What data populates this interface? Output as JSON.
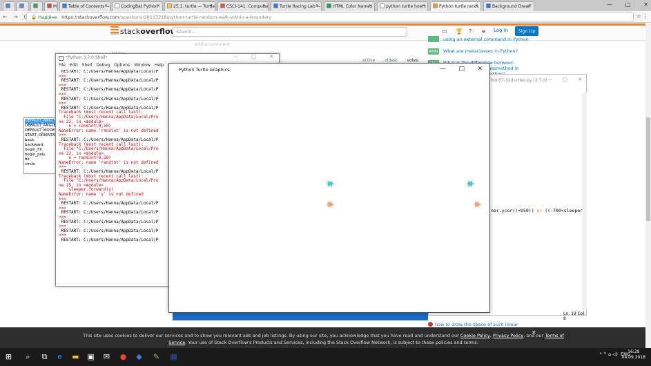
{
  "browser": {
    "tabs": [
      {
        "label": ""
      },
      {
        "label": ""
      },
      {
        "label": ""
      },
      {
        "label": "M"
      },
      {
        "label": "Table of Contents —"
      },
      {
        "label": "CodingBat Python"
      },
      {
        "label": "25.1. turtle — Turtle"
      },
      {
        "label": "CSCI-141: Computer"
      },
      {
        "label": "Turtle Racing Lab —"
      },
      {
        "label": "HTML Color Names"
      },
      {
        "label": "python turtle how t"
      },
      {
        "label": "Python turtle randc"
      },
      {
        "label": "Background Drawi"
      }
    ],
    "window_buttons": [
      "—",
      "□",
      "✕"
    ],
    "nav_buttons": "← → C",
    "secure_label": "Надійне",
    "url_host": "https://stackoverflow.com",
    "url_path": "/questions/28113218/python-turtle-random-walk-within-a-boundary",
    "star": "☆",
    "menu": "⋮"
  },
  "stackoverflow": {
    "logo_plain": "stack",
    "logo_bold": "overflow",
    "search_placeholder": "Search...",
    "login": "Log In",
    "signup": "Sign Up",
    "add_comment": "add a comment",
    "home": "Home",
    "sort_tabs": [
      "active",
      "oldest",
      "votes"
    ],
    "related": [
      {
        "count": "",
        "text": "using an external command in Python"
      },
      {
        "count": "4640",
        "text": "What are metaclasses in Python?"
      },
      {
        "count": "2717",
        "text": "What is the difference between"
      },
      {
        "count": "",
        "text": "lassmethod in"
      },
      {
        "count": "",
        "text": "Python?"
      }
    ],
    "bottom_question": "how to draw the space of such linear",
    "cookie_line1_a": "This site uses cookies to deliver our services and to show you relevant ads and job listings. By using our site, you acknowledge that you have read and understand our ",
    "cookie_link1": "Cookie Policy",
    "cookie_sep": ", ",
    "cookie_link2": "Privacy Policy",
    "cookie_and": ", and our ",
    "cookie_link3": "Terms of",
    "cookie_link4": "Service",
    "cookie_line2": ". Your use of Stack Overflow's Products and Services, including the Stack Overflow Network, is subject to these policies and terms.",
    "cookie_close": "✕"
  },
  "autocomplete": [
    "DEFAULT_ANGLE",
    "DEFAULT_ANGLE",
    "DEFAULT_MODE",
    "START_ORIENTAT",
    "back",
    "backward",
    "begin_fill",
    "begin_poly",
    "bk",
    "circle"
  ],
  "shell": {
    "title": "*Python 3.7.0 Shell*",
    "window_buttons": [
      "—",
      "□",
      "✕"
    ],
    "menu": [
      "File",
      "Edit",
      "Shell",
      "Debug",
      "Options",
      "Window",
      "Help"
    ],
    "lines": [
      {
        "t": " RESTART: C:/Users/Hanna/AppData/Local/P",
        "c": "k"
      },
      {
        "t": ">>>",
        "c": "r"
      },
      {
        "t": " RESTART: C:/Users/Hanna/AppData/Local/P",
        "c": "k"
      },
      {
        "t": ">>>",
        "c": "r"
      },
      {
        "t": " RESTART: C:/Users/Hanna/AppData/Local/P",
        "c": "k"
      },
      {
        "t": ">>>",
        "c": "r"
      },
      {
        "t": " RESTART: C:/Users/Hanna/AppData/Local/P",
        "c": "k"
      },
      {
        "t": ">>>",
        "c": "r"
      },
      {
        "t": " RESTART: C:/Users/Hanna/AppData/Local/P",
        "c": "k"
      },
      {
        "t": "Traceback (most recent call last):",
        "c": "r"
      },
      {
        "t": "  File \"C:/Users/Hanna/AppData/Local/Pro",
        "c": "r"
      },
      {
        "t": "ne 22, in <module>",
        "c": "r"
      },
      {
        "t": "    n = randint(0,50)",
        "c": "r"
      },
      {
        "t": "NameError: name 'randint' is not defined",
        "c": "r"
      },
      {
        "t": ">>>",
        "c": "r"
      },
      {
        "t": " RESTART: C:/Users/Hanna/AppData/Local/P",
        "c": "k"
      },
      {
        "t": "Traceback (most recent call last):",
        "c": "r"
      },
      {
        "t": "  File \"C:/Users/Hanna/AppData/Local/Pro",
        "c": "r"
      },
      {
        "t": "ne 22, in <module>",
        "c": "r"
      },
      {
        "t": "    n = randint(0,50)",
        "c": "r"
      },
      {
        "t": "NameError: name 'randint' is not defined",
        "c": "r"
      },
      {
        "t": ">>>",
        "c": "r"
      },
      {
        "t": " RESTART: C:/Users/Hanna/AppData/Local/P",
        "c": "k"
      },
      {
        "t": "Traceback (most recent call last):",
        "c": "r"
      },
      {
        "t": "  File \"C:/Users/Hanna/AppData/Local/Pro",
        "c": "r"
      },
      {
        "t": "ne 25, in <module>",
        "c": "r"
      },
      {
        "t": "    sleeper.forward(y)",
        "c": "r"
      },
      {
        "t": "NameError: name 'y' is not defined",
        "c": "r"
      },
      {
        "t": ">>>",
        "c": "r"
      },
      {
        "t": " RESTART: C:/Users/Hanna/AppData/Local/P",
        "c": "k"
      },
      {
        "t": ">>>",
        "c": "r"
      },
      {
        "t": " RESTART: C:/Users/Hanna/AppData/Local/P",
        "c": "k"
      },
      {
        "t": ">>>",
        "c": "r"
      },
      {
        "t": " RESTART: C:/Users/Hanna/AppData/Local/P",
        "c": "k"
      },
      {
        "t": ">>>",
        "c": "r"
      },
      {
        "t": " RESTART: C:/Users/Hanna/AppData/Local/P",
        "c": "k"
      },
      {
        "t": ">>>",
        "c": "r"
      },
      {
        "t": " RESTART: C:/Users/Hanna/AppData/Local/P",
        "c": "k"
      }
    ]
  },
  "turtle_window": {
    "title": "Python Turtle Graphics",
    "window_buttons": [
      "—",
      "□",
      "✕"
    ],
    "turtles": [
      {
        "color": "#4fc3d9"
      },
      {
        "color": "#4fc3d9"
      },
      {
        "color": "#f4a07a"
      },
      {
        "color": "#f4a07a"
      }
    ]
  },
  "editor": {
    "title": "hon37-32/turtles.py (3.7.0)",
    "window_buttons": [
      "—",
      "□",
      "✕"
    ],
    "code_a": "ner.ycor()<950)) ",
    "code_or": "or",
    "code_b": " ((-700<sleeper",
    "status": "Ln: 19  Col: 8"
  },
  "taskbar": {
    "tray_text": "ENG",
    "tray_icons": "ᴿ  ^  ⌂ ◁)",
    "time": "16:29",
    "date": "04.09.2018",
    "icons": [
      "⊞",
      "⌕",
      "⧉",
      "e",
      "▬",
      "▣",
      "✉",
      "●",
      "◆",
      "✎",
      "▦"
    ]
  }
}
